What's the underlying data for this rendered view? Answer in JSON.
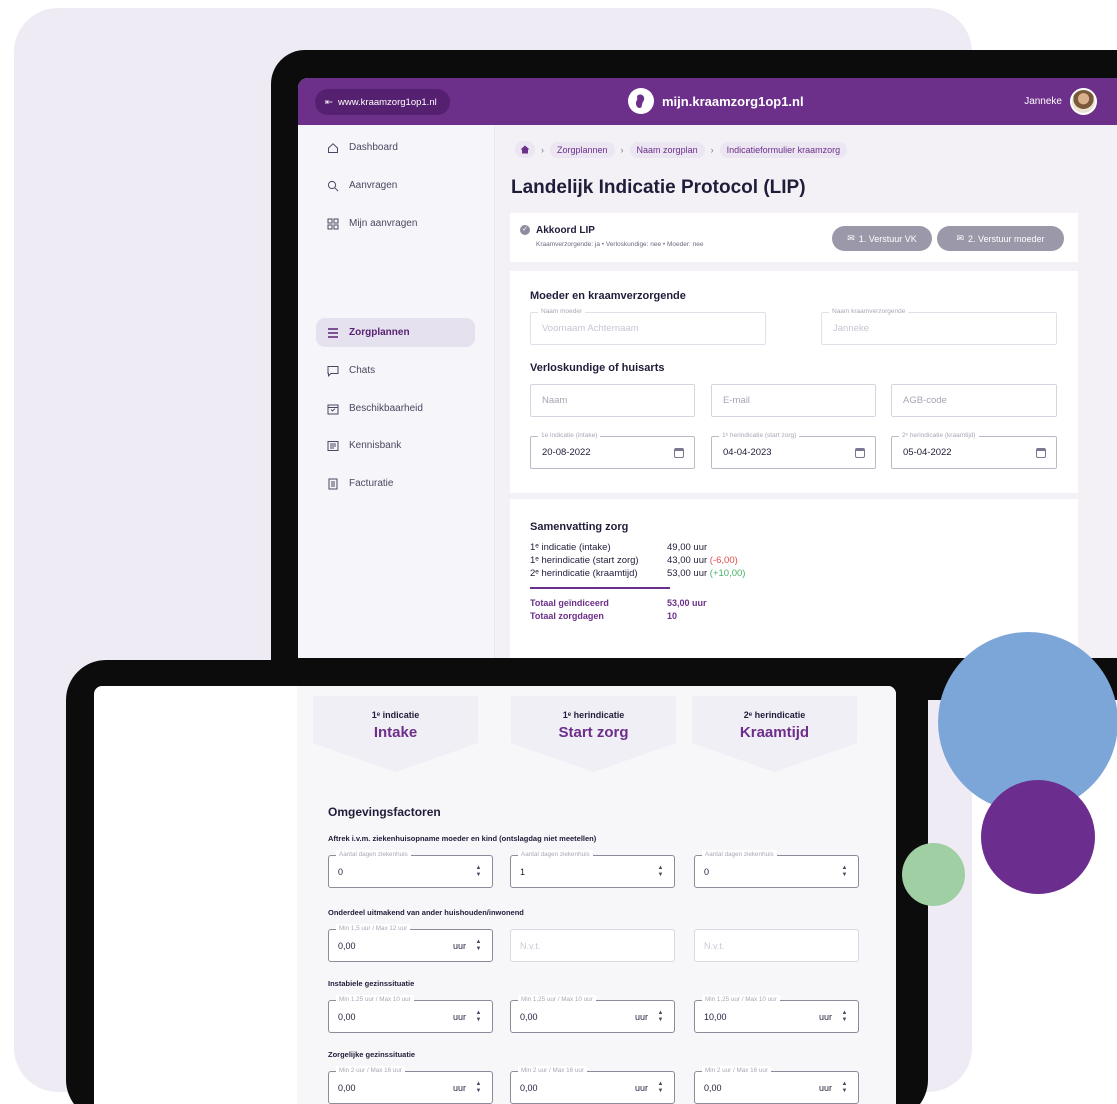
{
  "topbar": {
    "website": "www.kraamzorg1op1.nl",
    "brand": "mijn.kraamzorg1op1.nl",
    "user_name": "Janneke"
  },
  "sidebar": {
    "items": [
      {
        "label": "Dashboard",
        "icon": "home-icon"
      },
      {
        "label": "Aanvragen",
        "icon": "search-icon"
      },
      {
        "label": "Mijn aanvragen",
        "icon": "grid-icon"
      },
      {
        "label": "Zorgplannen",
        "icon": "list-icon",
        "active": true
      },
      {
        "label": "Chats",
        "icon": "chat-icon"
      },
      {
        "label": "Beschikbaarheid",
        "icon": "calendar-icon"
      },
      {
        "label": "Kennisbank",
        "icon": "book-icon"
      },
      {
        "label": "Facturatie",
        "icon": "invoice-icon"
      }
    ]
  },
  "breadcrumb": [
    "Zorgplannen",
    "Naam zorgplan",
    "Indicatieformulier kraamzorg"
  ],
  "page_title": "Landelijk Indicatie Protocol (LIP)",
  "approval": {
    "title": "Akkoord LIP",
    "subtitle": "Kraamverzorgende: ja • Verloskundige: nee • Moeder: nee",
    "send_vk": "1. Verstuur VK",
    "send_mother": "2. Verstuur moeder"
  },
  "form": {
    "section1": "Moeder en kraamverzorgende",
    "mother_label": "Naam moeder",
    "mother_placeholder": "Voornaam Achternaam",
    "vk_label": "Naam kraamverzorgende",
    "vk_value": "Janneke",
    "section2": "Verloskundige of huisarts",
    "name_placeholder": "Naam",
    "email_placeholder": "E-mail",
    "agb_placeholder": "AGB-code",
    "date1_label": "1e indicatie (intake)",
    "date1": "20-08-2022",
    "date2_label": "1ᵉ herindicatie (start zorg)",
    "date2": "04-04-2023",
    "date3_label": "2ᵉ herindicatie (kraamtijd)",
    "date3": "05-04-2022"
  },
  "summary": {
    "title": "Samenvatting zorg",
    "rows": [
      {
        "label": "1ᵉ indicatie (intake)",
        "value": "49,00 uur",
        "delta": ""
      },
      {
        "label": "1ᵉ herindicatie (start zorg)",
        "value": "43,00 uur",
        "delta": "(-6,00)"
      },
      {
        "label": "2ᵉ herindicatie (kraamtijd)",
        "value": "53,00 uur",
        "delta": "(+10,00)"
      }
    ],
    "total_label": "Totaal geïndiceerd",
    "total_value": "53,00 uur",
    "days_label": "Totaal zorgdagen",
    "days_value": "10"
  },
  "tabs": [
    {
      "small": "1ᵉ indicatie",
      "big": "Intake"
    },
    {
      "small": "1ᵉ herindicatie",
      "big": "Start zorg"
    },
    {
      "small": "2ᵉ herindicatie",
      "big": "Kraamtijd"
    }
  ],
  "factors": {
    "title": "Omgevingsfactoren",
    "group1": "Aftrek i.v.m. ziekenhuisopname moeder en kind (ontslagdag niet meetellen)",
    "group1_label": "Aantal dagen ziekenhuis",
    "group1_values": [
      "0",
      "1",
      "0"
    ],
    "group2": "Onderdeel uitmakend van ander huishouden/inwonend",
    "group2_label": "Min 1,5 uur / Max 12 uur",
    "group2_value": "0,00",
    "group2_na": "N.v.t.",
    "group3": "Instabiele gezinssituatie",
    "group3_label": "Min 1,25 uur / Max 10 uur",
    "group3_values": [
      "0,00",
      "0,00",
      "10,00"
    ],
    "group4": "Zorgelijke gezinssituatie",
    "group4_label": "Min 2 uur / Max 16 uur",
    "group4_values": [
      "0,00",
      "0,00",
      "0,00"
    ],
    "unit": "uur"
  },
  "colors": {
    "brand_purple": "#6c2f8a",
    "circle_blue": "#7da6d8",
    "circle_purple": "#6b2d8e",
    "circle_green": "#9fcfa3"
  }
}
